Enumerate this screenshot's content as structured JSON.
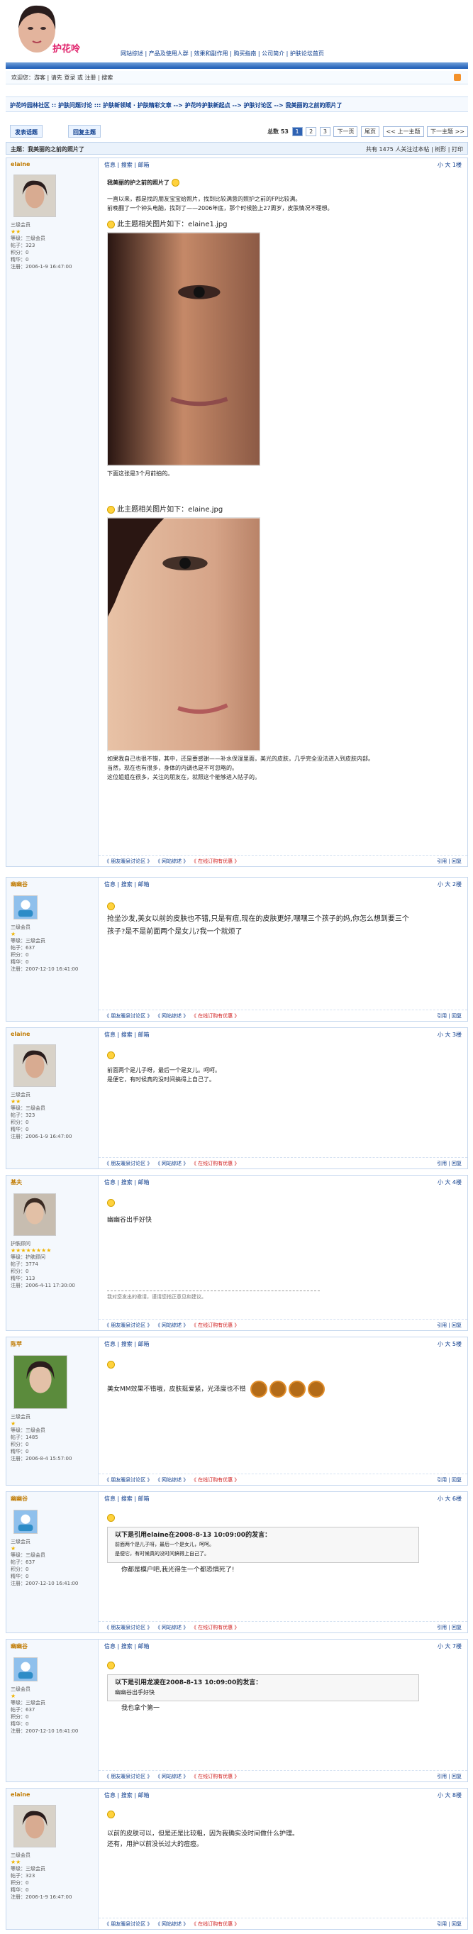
{
  "topnav": "网站综述 | 产品及使用人群 | 效果和副作用 | 购买指南 | 公司简介 | 护肤论坛首页",
  "logo_text": "护花呤",
  "userbar": "欢迎您：游客 | 请先 登录 或 注册 | 搜索",
  "crumb": "护花吟园林社区 :: 护肤问题讨论 ::: 护肤新领域 · 护肤精彩文章 --> 护花吟护肤新起点 --> 护肤讨论区 --> 我美丽的之前的照片了",
  "new_topic": "发表话题",
  "reply_topic": "回复主题",
  "pager": {
    "total": "总数 53",
    "pages": [
      "1",
      "2",
      "3"
    ],
    "next": "下一页",
    "last": "尾页",
    "prev_topic": "<< 上一主题",
    "next_topic": "下一主题 >>"
  },
  "topic": {
    "title": "主题：我美丽的之前的照片了",
    "right": "共有 1475 人关注过本帖 | 树形 | 打印"
  },
  "posts": [
    {
      "author": "elaine",
      "group": "三级会员",
      "stars": "★★",
      "rank": "等级：三级会员",
      "posts": "帖子：323",
      "credit": "积分：0",
      "score": "精华：0",
      "reg": "注册：2006-1-9 16:47:00",
      "tool": "信息 | 搜索 | 邮箱",
      "num": "小 大 1楼",
      "heading": "我美丽的护之前的照片了",
      "p1": "一直以来，都是找的朋友宝宝给照片，找到比较满意的照护之前的FP比较满。",
      "p2": "前晚翻了一个钟头电脑，找到了——2006年底，那个时候脸上27周岁，皮肤情况不理想。",
      "img1": "此主题相关图片如下：elaine1.jpg",
      "cap1": "下面这张是3个月前拍的。",
      "img2": "此主题相关图片如下：elaine.jpg",
      "p3": "如果我自己也很不错，其中，还是要感谢——补水保湿里面，美光的皮肤，几乎完全没法进入到皮肤内部。",
      "p4": "当然，现在也有很多，身体的内调也是不可忽略的。",
      "p5": "这位姐姐在很多，关注的朋友在，就照这个能够进入帖子的。",
      "reply": "引用 | 回复"
    },
    {
      "author": "幽幽谷",
      "group": "三级会员",
      "stars": "★",
      "rank": "等级：三级会员",
      "posts": "帖子：637",
      "credit": "积分：0",
      "score": "精华：0",
      "reg": "注册：2007-12-10 16:41:00",
      "tool": "信息 | 搜索 | 邮箱",
      "num": "小 大 2楼",
      "text": "抢坐沙发,美女以前的皮肤也不错,只是有痘,现在的皮肤更好,嘿嘿三个孩子的妈,你怎么想到要三个孩子?是不是前面两个是女儿?我一个就烦了"
    },
    {
      "author": "elaine",
      "group": "三级会员",
      "stars": "★★",
      "rank": "等级：三级会员",
      "posts": "帖子：323",
      "credit": "积分：0",
      "score": "精华：0",
      "reg": "注册：2006-1-9 16:47:00",
      "tool": "信息 | 搜索 | 邮箱",
      "num": "小 大 3楼",
      "text": "前面两个是儿子呀，最后一个是女儿。呵呵。",
      "text2": "是便它，有时候真的没时间搞得上自己了。"
    },
    {
      "author": "基夫",
      "group": "护肤顾问",
      "stars": "★★★★★★★★",
      "rank": "等级：护肤顾问",
      "posts": "帖子：3774",
      "credit": "积分：0",
      "score": "精华：113",
      "reg": "注册：2006-4-11 17:30:00",
      "tool": "信息 | 搜索 | 邮箱",
      "num": "小 大 4楼",
      "text": "幽幽谷出手好快",
      "sig": "我对您发出的邀请，谨请您指正意见和建议。"
    },
    {
      "author": "陈苹",
      "group": "三级会员",
      "stars": "★",
      "rank": "等级：三级会员",
      "posts": "帖子：1485",
      "credit": "积分：0",
      "score": "精华：0",
      "reg": "注册：2006-8-4 15:57:00",
      "tool": "信息 | 搜索 | 邮箱",
      "num": "小 大 5楼",
      "text": "美女MM效果不错哦，皮肤挺爱紧，光泽度也不错"
    },
    {
      "author": "幽幽谷",
      "group": "三级会员",
      "stars": "★",
      "rank": "等级：三级会员",
      "posts": "帖子：637",
      "credit": "积分：0",
      "score": "精华：0",
      "reg": "注册：2007-12-10 16:41:00",
      "tool": "信息 | 搜索 | 邮箱",
      "num": "小 大 6楼",
      "quote_head": "以下是引用elaine在2008-8-13 10:09:00的发言：",
      "quote1": "前面两个是儿子呀，最后一个是女儿，呵呵。",
      "quote2": "是便它，有时候真的没时间搞得上自己了。",
      "text": "你都是模户吧,我光得生一个都恐惧死了!"
    },
    {
      "author": "幽幽谷",
      "group": "三级会员",
      "stars": "★",
      "rank": "等级：三级会员",
      "posts": "帖子：637",
      "credit": "积分：0",
      "score": "精华：0",
      "reg": "注册：2007-12-10 16:41:00",
      "tool": "信息 | 搜索 | 邮箱",
      "num": "小 大 7楼",
      "quote_head": "以下是引用龙凌在2008-8-13 10:09:00的发言：",
      "quote1": "幽幽谷出手好快",
      "text": "我也拿个第一"
    },
    {
      "author": "elaine",
      "group": "三级会员",
      "stars": "★★",
      "rank": "等级：三级会员",
      "posts": "帖子：323",
      "credit": "积分：0",
      "score": "精华：0",
      "reg": "注册：2006-1-9 16:47:00",
      "tool": "信息 | 搜索 | 邮箱",
      "num": "小 大 8楼",
      "text": "以前的皮肤可以，但是还是比较粗，因为我确实没时间做什么护理。",
      "text2": "还有，用护以前没长过大的痘痘。"
    }
  ],
  "ads": [
    "《 朋友暖泉讨论区 》",
    "《 网站综述 》",
    "《 在线订购有优惠 》"
  ],
  "reply": "引用 | 回复"
}
